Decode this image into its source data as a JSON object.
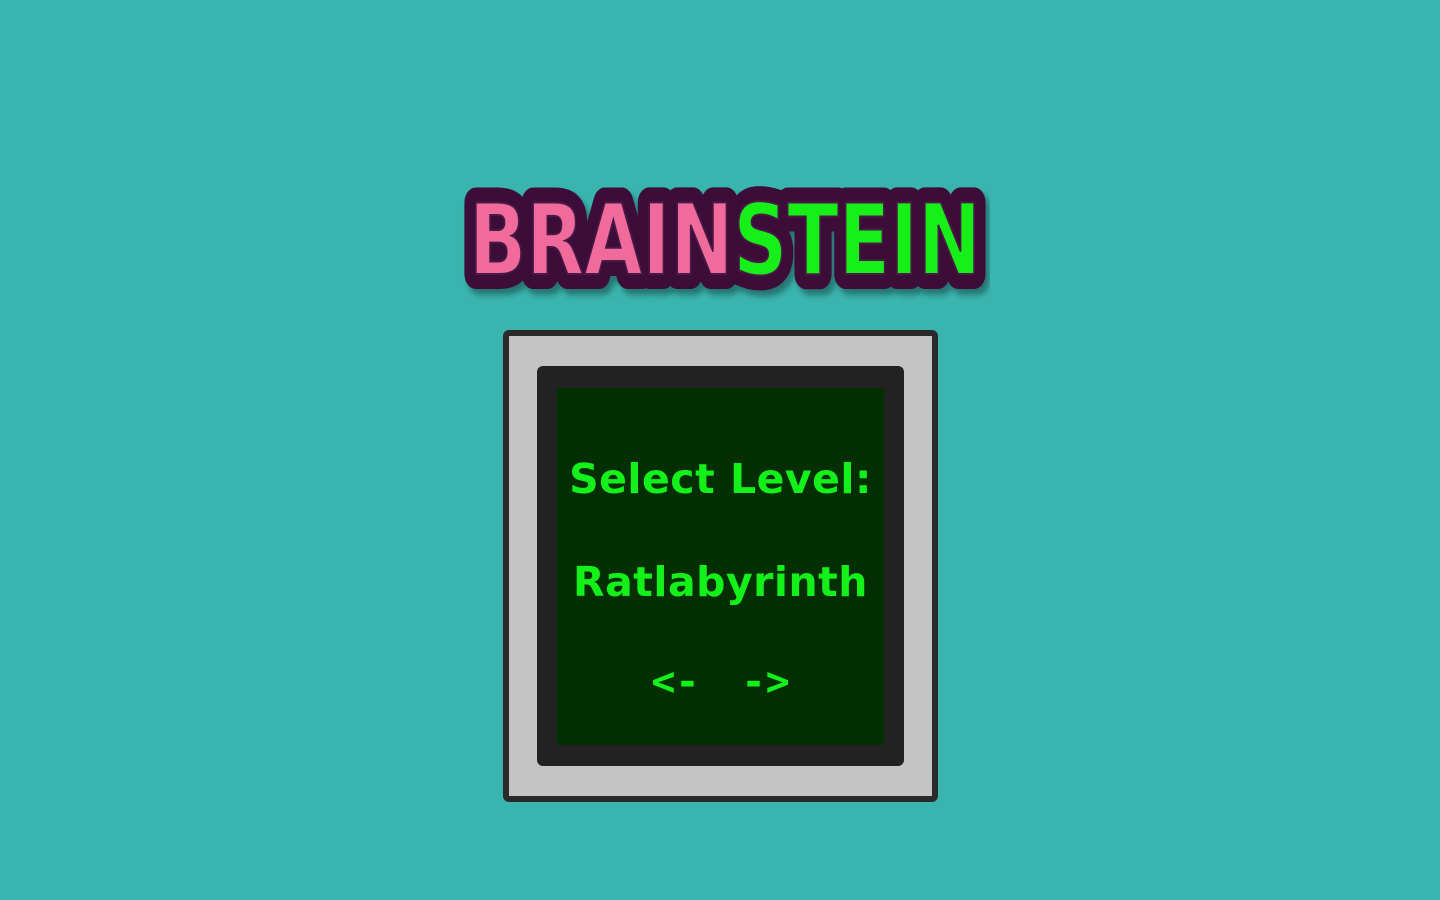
{
  "logo": {
    "part1": "BRAIN",
    "part2": "STEIN",
    "colors": {
      "part1_fill": "#f06a9c",
      "part2_fill": "#16f018",
      "outline": "#3b0f38"
    }
  },
  "level_select": {
    "label": "Select Level:",
    "current_level": "Ratlabyrinth",
    "prev_label": "<-",
    "next_label": "->"
  },
  "colors": {
    "background": "#3ab4ae",
    "monitor_frame": "#c4c4c4",
    "bezel": "#222222",
    "screen": "#032f03",
    "screen_text": "#14f01a"
  }
}
